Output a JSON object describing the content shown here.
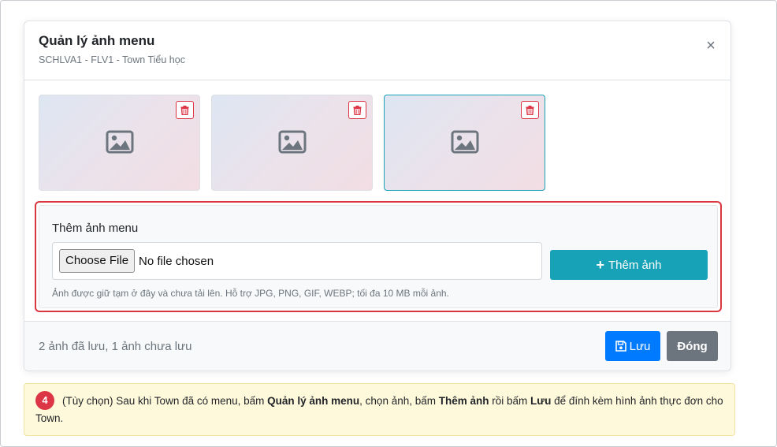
{
  "modal": {
    "title": "Quản lý ảnh menu",
    "subtitle": "SCHLVA1 - FLV1 - Town Tiểu học",
    "close_symbol": "×"
  },
  "images": [
    {
      "icon": "image-placeholder-icon",
      "delete_icon": "trash-icon",
      "selected": false
    },
    {
      "icon": "image-placeholder-icon",
      "delete_icon": "trash-icon",
      "selected": false
    },
    {
      "icon": "image-placeholder-icon",
      "delete_icon": "trash-icon",
      "selected": true
    }
  ],
  "add_panel": {
    "label": "Thêm ảnh menu",
    "file_button": "Choose File",
    "file_status": "No file chosen",
    "add_button": "Thêm ảnh",
    "add_icon": "+",
    "hint": "Ảnh được giữ tạm ở đây và chưa tải lên. Hỗ trợ JPG, PNG, GIF, WEBP; tối đa 10 MB mỗi ảnh."
  },
  "footer": {
    "status": "2 ảnh đã lưu, 1 ảnh chưa lưu",
    "save_button": "Lưu",
    "close_button": "Đóng"
  },
  "note": {
    "step": "4",
    "text_1": "(Tùy chọn) Sau khi Town đã có menu, bấm ",
    "bold_1": "Quản lý ảnh menu",
    "text_2": ", chọn ảnh, bấm ",
    "bold_2": "Thêm ảnh",
    "text_3": " rồi bấm ",
    "bold_3": "Lưu",
    "text_4": " để đính kèm hình ảnh thực đơn cho Town."
  },
  "colors": {
    "danger": "#dc3545",
    "info": "#17a2b8",
    "primary": "#007bff",
    "secondary": "#6c757d",
    "highlight_border": "#d9363e",
    "note_bg": "#fff9db"
  }
}
